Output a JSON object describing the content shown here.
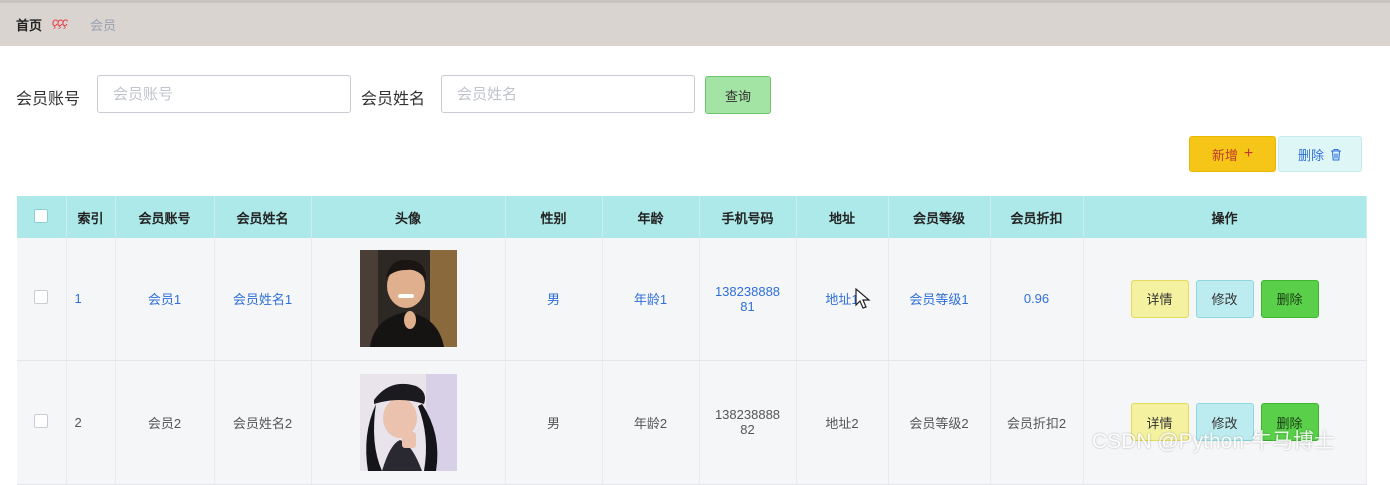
{
  "breadcrumb": {
    "home": "首页",
    "separator": "ççç",
    "current": "会员"
  },
  "search": {
    "account_label": "会员账号",
    "account_placeholder": "会员账号",
    "name_label": "会员姓名",
    "name_placeholder": "会员姓名",
    "query_button": "查询"
  },
  "toolbar": {
    "add_label": "新增",
    "add_icon": "plus-icon",
    "delete_label": "删除",
    "delete_icon": "trash-icon"
  },
  "table": {
    "columns": [
      "索引",
      "会员账号",
      "会员姓名",
      "头像",
      "性别",
      "年龄",
      "手机号码",
      "地址",
      "会员等级",
      "会员折扣",
      "操作"
    ],
    "rows": [
      {
        "index": "1",
        "account": "会员1",
        "name": "会员姓名1",
        "gender": "男",
        "age": "年龄1",
        "phone_l1": "138238888",
        "phone_l2": "81",
        "address": "地址1",
        "level": "会员等级1",
        "discount": "0.96"
      },
      {
        "index": "2",
        "account": "会员2",
        "name": "会员姓名2",
        "gender": "男",
        "age": "年龄2",
        "phone_l1": "138238888",
        "phone_l2": "82",
        "address": "地址2",
        "level": "会员等级2",
        "discount": "会员折扣2"
      }
    ],
    "actions": {
      "detail": "详情",
      "edit": "修改",
      "delete": "删除"
    }
  },
  "watermark": "CSDN @Python-牛马博士",
  "colors": {
    "header_bg": "#aee9ea",
    "query_bg": "#a3e3a3",
    "add_bg": "#f5c518",
    "link": "#2f6fd8"
  }
}
